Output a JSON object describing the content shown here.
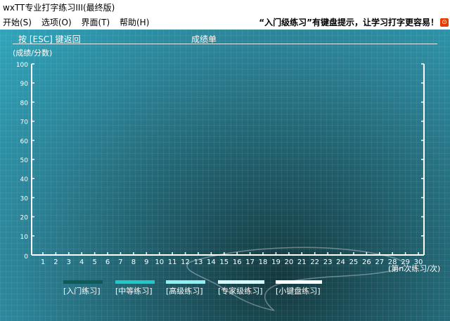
{
  "window": {
    "title": "wxTT专业打字练习III(最终版)"
  },
  "menu": {
    "items": [
      "开始(S)",
      "选项(O)",
      "界面(T)",
      "帮助(H)"
    ],
    "hint": "“入门级练习”有键盘提示，让学习打字更容易！",
    "close_glyph": "⊙"
  },
  "header": {
    "back_hint": "按 [ESC] 键返回",
    "title": "成绩单"
  },
  "chart_data": {
    "type": "line",
    "ylabel": "(成绩/分数)",
    "xlabel": "(第n次练习/次)",
    "ylim": [
      0,
      100
    ],
    "y_ticks": [
      "0",
      "10",
      "20",
      "30",
      "40",
      "50",
      "60",
      "70",
      "80",
      "90",
      "100"
    ],
    "x_ticks": [
      "1",
      "2",
      "3",
      "4",
      "5",
      "6",
      "7",
      "8",
      "9",
      "10",
      "11",
      "12",
      "13",
      "14",
      "15",
      "16",
      "17",
      "18",
      "19",
      "20",
      "21",
      "22",
      "23",
      "24",
      "25",
      "26",
      "27",
      "28",
      "29",
      "30"
    ],
    "grid": false,
    "series": [
      {
        "name": "[入门练习]",
        "color": "#0f5a54",
        "values": []
      },
      {
        "name": "[中等练习]",
        "color": "#1fc9c9",
        "values": []
      },
      {
        "name": "[高级练习]",
        "color": "#8ef0f0",
        "values": []
      },
      {
        "name": "[专家级练习]",
        "color": "#d6f8f8",
        "values": []
      },
      {
        "name": "[小键盘练习]",
        "color": "#ffffff",
        "values": []
      }
    ]
  }
}
